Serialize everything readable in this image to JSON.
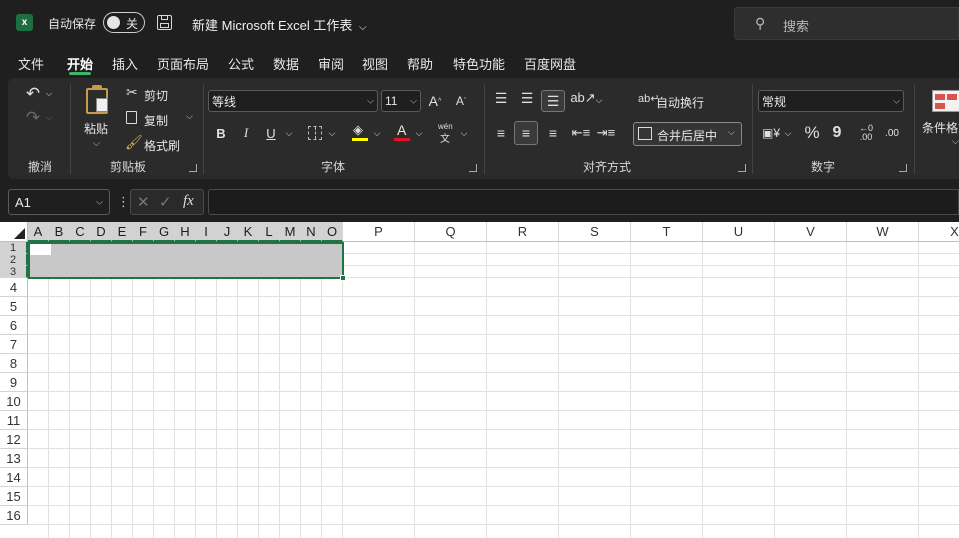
{
  "titlebar": {
    "autosave_label": "自动保存",
    "autosave_state": "关",
    "doc_title": "新建 Microsoft Excel 工作表",
    "search_placeholder": "搜索"
  },
  "tabs": [
    "文件",
    "开始",
    "插入",
    "页面布局",
    "公式",
    "数据",
    "审阅",
    "视图",
    "帮助",
    "特色功能",
    "百度网盘"
  ],
  "active_tab": "开始",
  "ribbon": {
    "undo_group": "撤消",
    "clipboard": {
      "paste": "粘贴",
      "cut": "剪切",
      "copy": "复制",
      "format_painter": "格式刷",
      "group": "剪贴板"
    },
    "font": {
      "name": "等线",
      "size": "11",
      "bold": "B",
      "italic": "I",
      "underline": "U",
      "grow": "A",
      "shrink": "A",
      "color_glyph": "A",
      "phonetic": "wén",
      "group": "字体"
    },
    "alignment": {
      "wrap": "自动换行",
      "merge": "合并后居中",
      "group": "对齐方式"
    },
    "number": {
      "format": "常规",
      "percent": "%",
      "comma": "9",
      "inc_dec": ".00",
      "group": "数字"
    },
    "styles": {
      "conditional": "条件格式"
    }
  },
  "formula_bar": {
    "name_box": "A1",
    "fx": "fx",
    "formula": ""
  },
  "columns_narrow": [
    "A",
    "B",
    "C",
    "D",
    "E",
    "F",
    "G",
    "H",
    "I",
    "J",
    "K",
    "L",
    "M",
    "N",
    "O"
  ],
  "columns_wide": [
    "P",
    "Q",
    "R",
    "S",
    "T",
    "U",
    "V",
    "W",
    "X"
  ],
  "rows": [
    "1",
    "2",
    "3",
    "4",
    "5",
    "6",
    "7",
    "8",
    "9",
    "10",
    "11",
    "12",
    "13",
    "14",
    "15",
    "16"
  ],
  "colors": {
    "accent": "#217346",
    "selection": "#c8c8c8",
    "chrome": "#1f1f1f",
    "ribbon": "#2b2b2b",
    "tab_underline": "#3fb36b",
    "font_color_bar": "#e81123",
    "highlight_bar": "#ffff00"
  }
}
